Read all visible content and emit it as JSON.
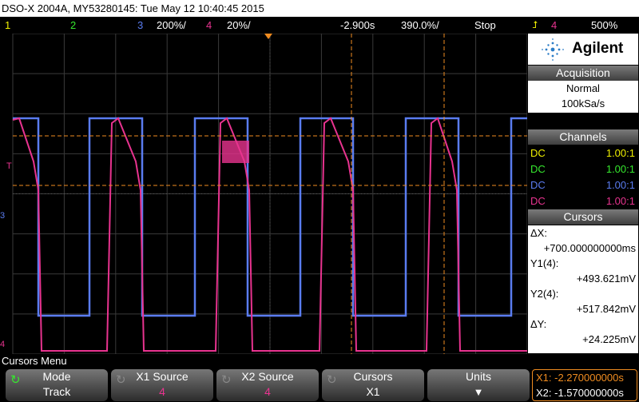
{
  "title": "DSO-X 2004A, MY53280145: Tue May 12 10:40:45 2015",
  "status": {
    "ch1_label": "1",
    "ch2_label": "2",
    "ch3_label": "3",
    "ch3_scale": "200%/",
    "ch4_label": "4",
    "ch4_scale": "20%/",
    "trigger_time": "-2.900s",
    "timebase": "390.0%/",
    "run_state": "Stop",
    "trig_source": "4",
    "trig_level": "500%"
  },
  "screen_markers": {
    "trig_marker": "T",
    "ch3_marker": "3",
    "ch4_marker": "4"
  },
  "brand": {
    "name": "Agilent"
  },
  "acquisition": {
    "header": "Acquisition",
    "mode": "Normal",
    "rate": "100kSa/s"
  },
  "channels": {
    "header": "Channels",
    "rows": [
      {
        "coupling": "DC",
        "ratio": "1.00:1",
        "color": "#f0f000"
      },
      {
        "coupling": "DC",
        "ratio": "1.00:1",
        "color": "#36e82e"
      },
      {
        "coupling": "DC",
        "ratio": "1.00:1",
        "color": "#5a7cf0"
      },
      {
        "coupling": "DC",
        "ratio": "1.00:1",
        "color": "#e8338f"
      }
    ]
  },
  "cursors": {
    "header": "Cursors",
    "dx_label": "ΔX:",
    "dx_value": "+700.000000000ms",
    "y1_label": "Y1(4):",
    "y1_value": "+493.621mV",
    "y2_label": "Y2(4):",
    "y2_value": "+517.842mV",
    "dy_label": "ΔY:",
    "dy_value": "+24.225mV"
  },
  "menu": {
    "title": "Cursors Menu",
    "keys": [
      {
        "label": "Mode",
        "value": "Track"
      },
      {
        "label": "X1 Source",
        "value": "4"
      },
      {
        "label": "X2 Source",
        "value": "4"
      },
      {
        "label": "Cursors",
        "value": "X1"
      },
      {
        "label": "Units",
        "value": ""
      }
    ],
    "x1_readout": "X1: -2.270000000s",
    "x2_readout": "X2: -1.570000000s"
  },
  "colors": {
    "ch1": "#f0f000",
    "ch2": "#36e82e",
    "ch3": "#5a7cf0",
    "ch4": "#e8338f",
    "cursor": "#f08c20"
  }
}
